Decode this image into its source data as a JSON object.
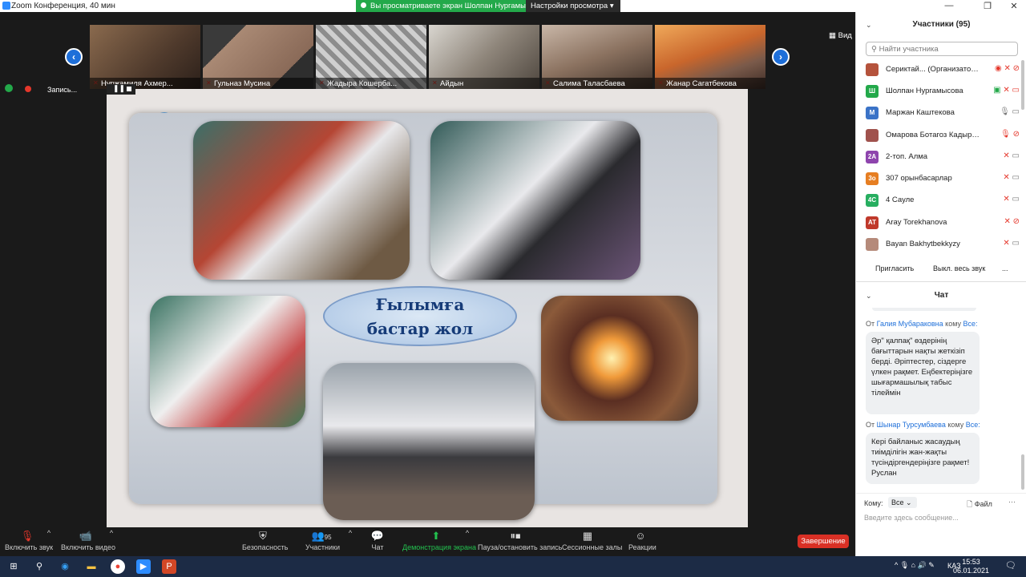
{
  "window": {
    "title": "Zoom Конференция, 40 мин"
  },
  "share_banner": {
    "viewing": "Вы просматриваете экран Шолпан Нургамысова",
    "view_options": "Настройки просмотра ▾"
  },
  "gallery": {
    "view_label": "Вид",
    "participants": [
      {
        "name": "Нуржамиля Ахмер...",
        "color": "#6b4a35"
      },
      {
        "name": "Гульназ Мусина",
        "color": "#8a6a58"
      },
      {
        "name": "Жадыра Кошерба...",
        "color": "#7d7a7a"
      },
      {
        "name": "Айдын",
        "color": "#5a5048"
      },
      {
        "name": "Салима Таласбаева",
        "color": "#6d5a4b"
      },
      {
        "name": "Жанар Сагатбекова",
        "color": "#c57a3d"
      }
    ]
  },
  "recording": {
    "label": "Запись..."
  },
  "slide": {
    "title_line1": "Ғылымға",
    "title_line2": "бастар жол"
  },
  "toolbar": {
    "unmute": "Включить звук",
    "start_video": "Включить видео",
    "security": "Безопасность",
    "participants": "Участники",
    "participants_count": "95",
    "chat": "Чат",
    "share": "Демонстрация экрана",
    "pause_record": "Пауза/остановить запись",
    "breakout": "Сессионные залы",
    "reactions": "Реакции",
    "end": "Завершение"
  },
  "panel": {
    "participants_title": "Участники (95)",
    "search_placeholder": "Найти участника",
    "participants": [
      {
        "name": "Сериктай... (Организатор, я)",
        "avatar": "",
        "color": "#b5533c"
      },
      {
        "name": "Шолпан Нургамысова",
        "avatar": "Ш",
        "color": "#23a94a"
      },
      {
        "name": "Маржан Каштекова",
        "avatar": "М",
        "color": "#3b73c7"
      },
      {
        "name": "Омарова Ботагоз Кадырбеков...",
        "avatar": "",
        "color": "#a0524d"
      },
      {
        "name": "2-топ. Алма",
        "avatar": "2А",
        "color": "#8e44ad"
      },
      {
        "name": "307 орынбасарлар",
        "avatar": "3о",
        "color": "#e67e22"
      },
      {
        "name": "4 Сауле",
        "avatar": "4С",
        "color": "#27ae60"
      },
      {
        "name": "Аray Torekhanova",
        "avatar": "AT",
        "color": "#c0392b"
      },
      {
        "name": "Bayan Bakhytbekkyzy",
        "avatar": "",
        "color": "#b58a7a"
      }
    ],
    "invite": "Пригласить",
    "mute_all": "Выкл. весь звук",
    "more": "...",
    "chat_title": "Чат",
    "messages": [
      {
        "from_prefix": "От",
        "sender": "Галия Мубараковна",
        "to_prefix": "кому",
        "to": "Все:",
        "text": "Әр\" қалпақ\" өздерінің бағыттарын нақты жеткізіп берді. Әріптестер, сіздерге үлкен рақмет. Еңбектеріңізге шығармашылық табыс тілеймін"
      },
      {
        "from_prefix": "От",
        "sender": "Шынар Турсумбаева",
        "to_prefix": "кому",
        "to": "Все:",
        "text": "Кері байланыс жасаудың тиімділігін жан-жақты түсіндіргендеріңізге рақмет! Руслан"
      }
    ],
    "to_label": "Кому:",
    "to_value": "Все",
    "file_label": "Файл",
    "input_placeholder": "Введите здесь сообщение..."
  },
  "taskbar": {
    "lang": "КАЗ",
    "time": "15:53",
    "date": "06.01.2021"
  }
}
